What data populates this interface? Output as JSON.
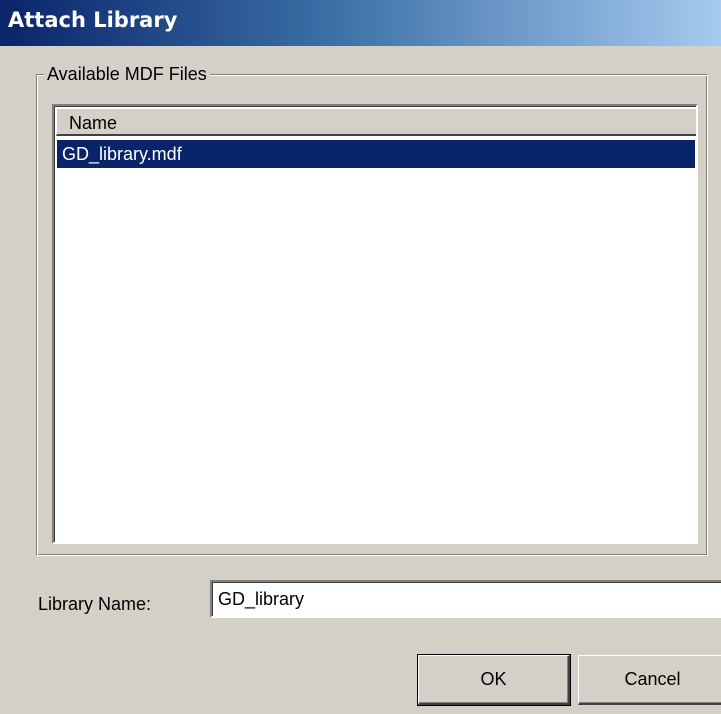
{
  "window": {
    "title": "Attach Library"
  },
  "available_files": {
    "group_label": "Available MDF Files",
    "columns": [
      "Name"
    ],
    "rows": [
      {
        "name": "GD_library.mdf",
        "selected": true
      }
    ]
  },
  "library_name": {
    "label": "Library Name:",
    "value": "GD_library"
  },
  "buttons": {
    "ok_label": "OK",
    "cancel_label": "Cancel"
  },
  "colors": {
    "title_bar_start": "#0a246a",
    "title_bar_end": "#a6caf0",
    "selection": "#0a246a",
    "face": "#d4d0c8"
  }
}
